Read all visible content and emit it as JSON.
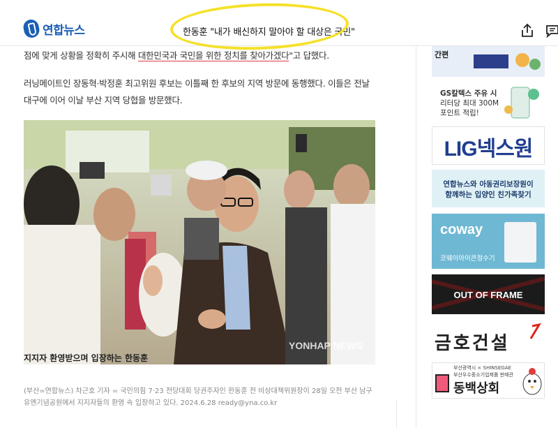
{
  "header": {
    "logo_text": "연합뉴스",
    "headline": "한동훈 \"내가 배신하지 말아야 할 대상은 국민\""
  },
  "article": {
    "p1_a": "점에 맞게 상황을 정확히 주시해 ",
    "p1_b": "대한민국과 국민을 위한 정치를 찾아가겠다",
    "p1_c": "\"고 답했다.",
    "p2": "러닝메이트인 장동혁·박정훈 최고위원 후보는 이틀째 한 후보의 지역 방문에 동행했다. 이들은 전날 대구에 이어 이날 부산 지역 당협을 방문했다.",
    "photo_watermark": "YONHAP NEWS",
    "caption_title": "지지자 환영받으며 입장하는 한동훈",
    "caption": "(부산=연합뉴스) 차근호 기자 = 국민의힘 7·23 전당대회 당권주자인 한동훈 전 비상대책위원장이 28일 오전 부산 남구 유엔기념공원에서 지지자들의 환영 속 입장하고 있다. 2024.6.28 ready@yna.co.kr"
  },
  "ads": {
    "ad1_text": "간편",
    "gs_line1": "GS칼텍스 주유 시",
    "gs_line2": "리터당 최대 300M",
    "gs_line3": "포인트 적립!",
    "lig": "LIG넥스원",
    "yna_line1": "연합뉴스와 아동권리보장원이",
    "yna_line2": "함께하는 입양인 친가족찾기",
    "coway_logo": "coway",
    "coway_sub": "코웨이아이콘정수기",
    "frame": "OUT OF FRAME",
    "kumho": "금호건설",
    "dongbaek_top": "부산광역시 × SHINSEGAE",
    "dongbaek_sub": "부산우수중소기업제품 판매관",
    "dongbaek_name": "동백상회"
  },
  "colors": {
    "brand_blue": "#1a5fb4",
    "highlight_yellow": "#f5e12a",
    "underline_red": "#e23b3b"
  },
  "icons": [
    "share-icon",
    "comment-icon"
  ]
}
